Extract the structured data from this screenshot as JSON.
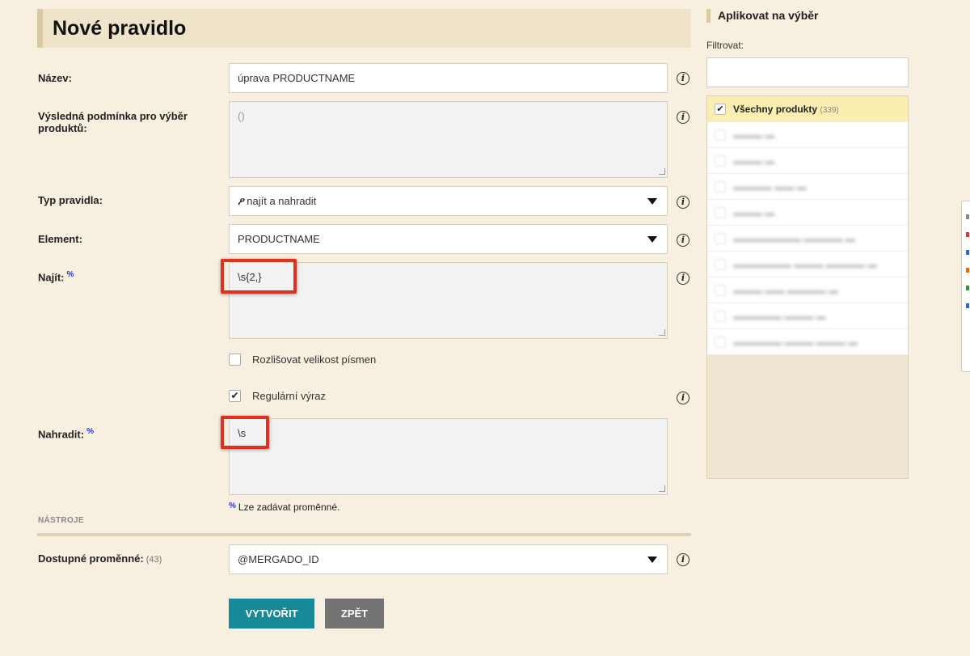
{
  "page": {
    "title": "Nové pravidlo"
  },
  "form": {
    "name": {
      "label": "Název:",
      "value": "úprava PRODUCTNAME"
    },
    "condition": {
      "label": "Výsledná podmínka pro výběr produktů:",
      "placeholder": "()"
    },
    "rule_type": {
      "label": "Typ pravidla:",
      "value": "najít a nahradit",
      "icon": "find-replace-icon"
    },
    "element": {
      "label": "Element:",
      "value": "PRODUCTNAME"
    },
    "find": {
      "label": "Najít:",
      "marker": "%",
      "value": "\\s{2,}"
    },
    "case_sensitive": {
      "label": "Rozlišovat velikost písmen",
      "checked": false
    },
    "regex": {
      "label": "Regulární výraz",
      "checked": true
    },
    "replace": {
      "label": "Nahradit:",
      "marker": "%",
      "value": "\\s"
    },
    "hint": {
      "marker": "%",
      "text": "Lze zadávat proměnné."
    }
  },
  "tools": {
    "section_label": "NÁSTROJE",
    "variables": {
      "label": "Dostupné proměnné:",
      "count": "(43)",
      "value": "@MERGADO_ID"
    }
  },
  "buttons": {
    "create": "VYTVOŘIT",
    "back": "ZPĚT"
  },
  "sidebar": {
    "title": "Aplikovat na výběr",
    "filter_label": "Filtrovat:",
    "all_products": {
      "label": "Všechny produkty",
      "count": "(339)",
      "checked": true
    }
  },
  "colors": {
    "accent": "#178a9a",
    "highlight": "#e0301e",
    "background": "#f7efdf"
  }
}
